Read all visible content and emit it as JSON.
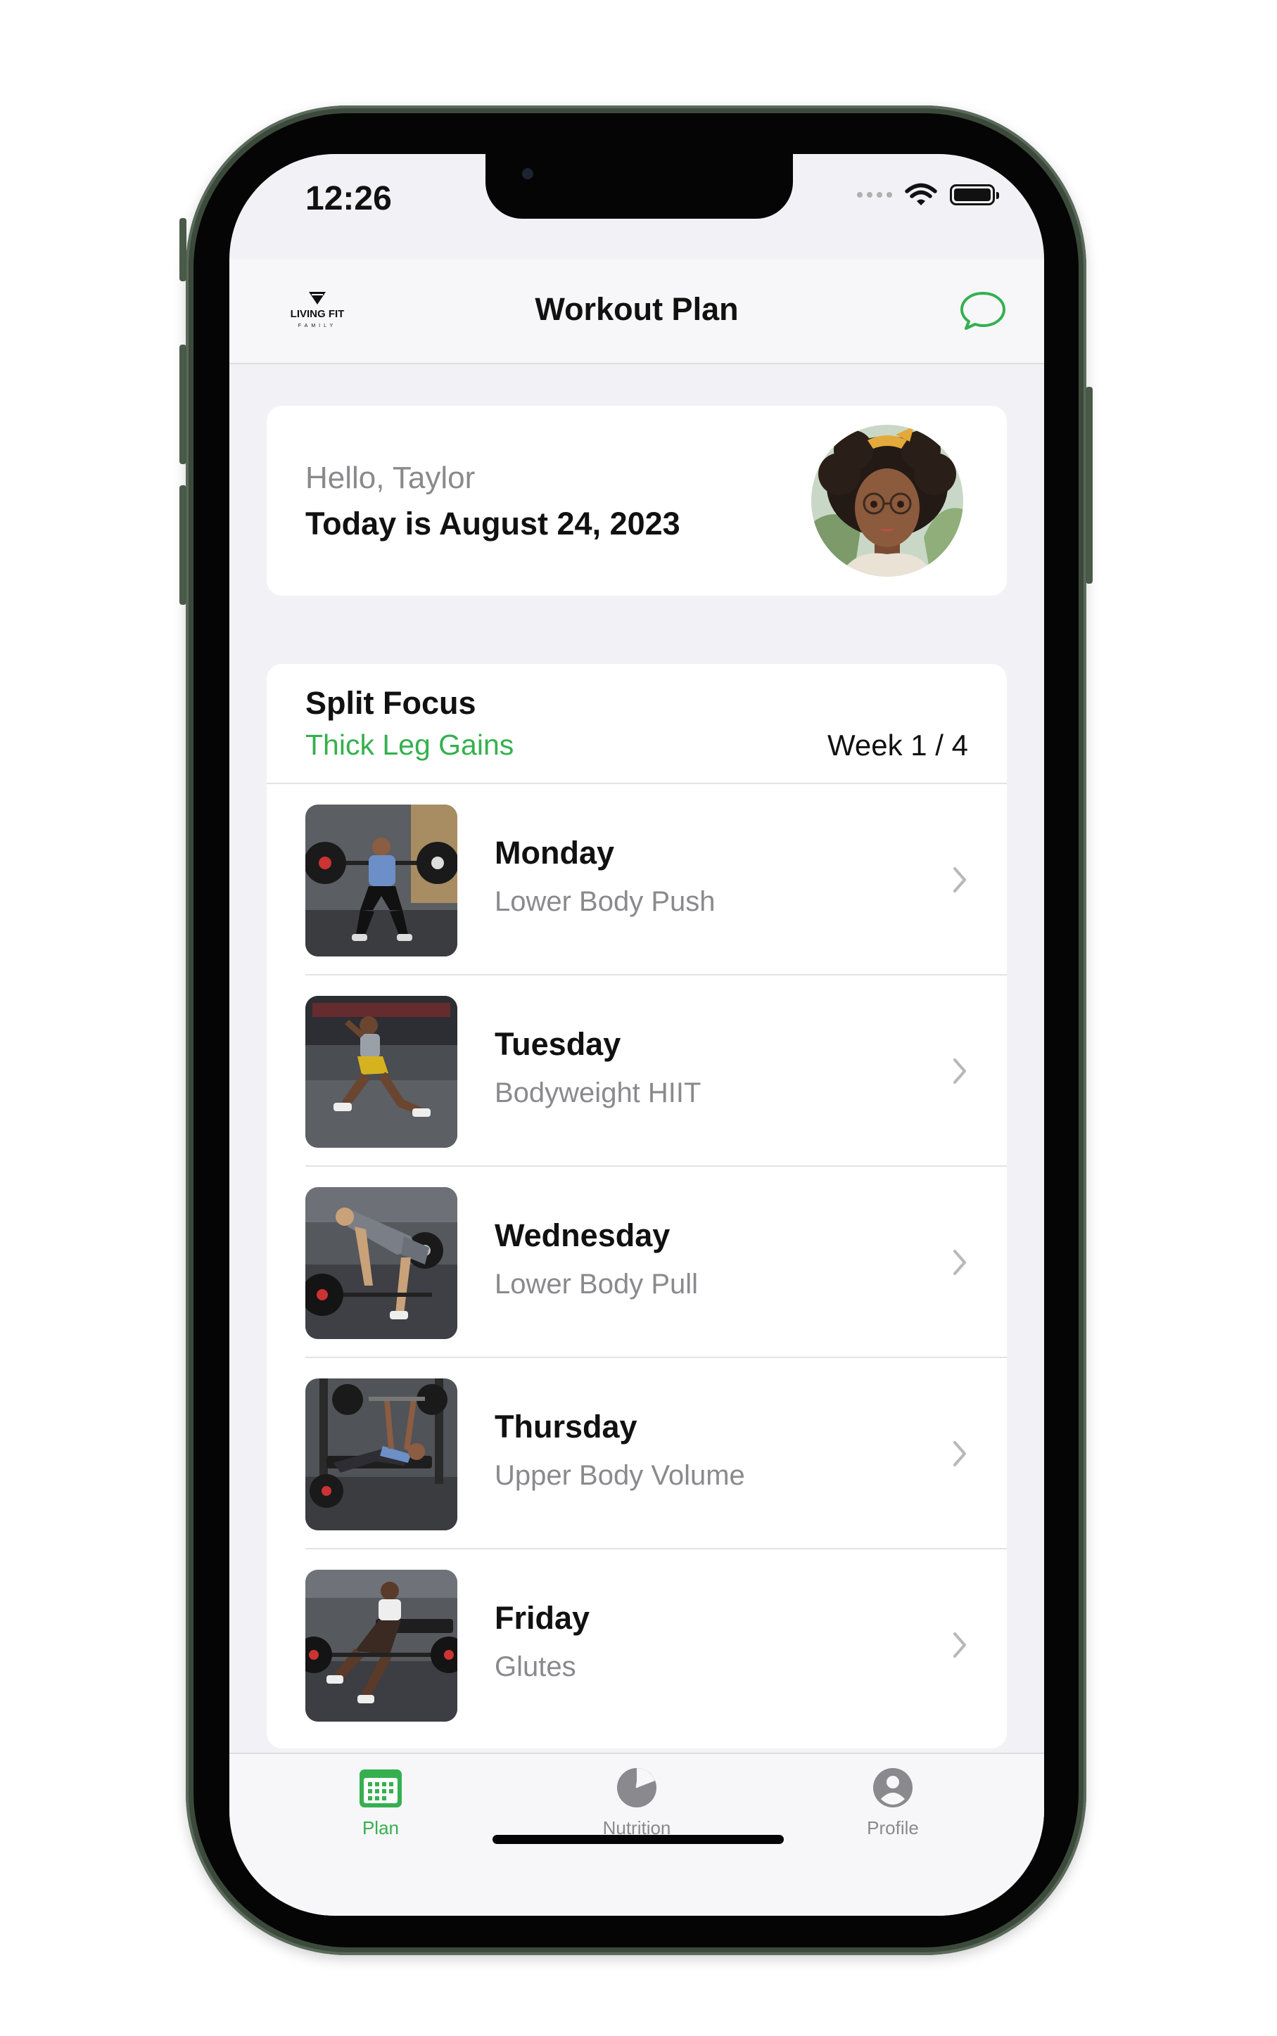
{
  "status_bar": {
    "time": "12:26"
  },
  "nav": {
    "title": "Workout Plan",
    "logo_text": "LIVING FIT",
    "logo_subtext": "FAMILY"
  },
  "greeting": {
    "hello": "Hello, Taylor",
    "date": "Today is August 24, 2023"
  },
  "split": {
    "title": "Split Focus",
    "program": "Thick Leg Gains",
    "week": "Week 1 / 4",
    "days": [
      {
        "name": "Monday",
        "workout": "Lower Body Push"
      },
      {
        "name": "Tuesday",
        "workout": "Bodyweight HIIT"
      },
      {
        "name": "Wednesday",
        "workout": "Lower Body Pull"
      },
      {
        "name": "Thursday",
        "workout": "Upper Body Volume"
      },
      {
        "name": "Friday",
        "workout": "Glutes"
      }
    ]
  },
  "tabs": [
    {
      "label": "Plan",
      "icon": "calendar-icon",
      "active": true
    },
    {
      "label": "Nutrition",
      "icon": "pie-chart-icon",
      "active": false
    },
    {
      "label": "Profile",
      "icon": "person-icon",
      "active": false
    }
  ],
  "colors": {
    "accent": "#35b04f",
    "text_primary": "#111111",
    "text_secondary": "#8a8a8e",
    "background": "#f2f2f6"
  }
}
